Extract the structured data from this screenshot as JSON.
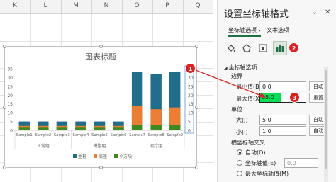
{
  "sheet": {
    "columns": [
      "K",
      "L",
      "M",
      "N",
      "O",
      "P",
      "Q"
    ]
  },
  "chart_data": {
    "type": "bar",
    "title": "图表标题",
    "categories": [
      "Sample1",
      "Sample2",
      "Sample3",
      "Sample4",
      "Sample5",
      "Sample6",
      "Sample7",
      "Sample8",
      "Sample9"
    ],
    "groups": [
      {
        "label": "正常组",
        "from": 0,
        "to": 2
      },
      {
        "label": "模型组",
        "from": 3,
        "to": 5
      },
      {
        "label": "治疗组",
        "from": 6,
        "to": 8
      }
    ],
    "bars": [
      {
        "name": "主柱",
        "color": "#1f6e8c",
        "values": [
          5,
          5,
          5,
          5,
          5,
          5,
          33,
          32,
          33
        ]
      },
      {
        "name": "底座",
        "color": "#ed7d31",
        "values": [
          2.5,
          2.5,
          2.5,
          2.5,
          2.5,
          2.5,
          14,
          12,
          13
        ]
      },
      {
        "name": "小方块",
        "color": "#3c8a1e",
        "values": [
          1.5,
          1.5,
          1.5,
          1.5,
          1.5,
          1.5,
          3,
          3,
          3
        ]
      }
    ],
    "primary_axis": {
      "ticks": [
        "0",
        "5",
        "10",
        "15",
        "20",
        "25",
        "30",
        "35"
      ],
      "ylim": [
        0,
        35
      ]
    },
    "secondary_axis": {
      "ticks": [
        "0",
        "5",
        "10",
        "15",
        "20",
        "25",
        "30",
        "35"
      ],
      "ylim": [
        0,
        35
      ]
    },
    "legend_position": "bottom",
    "grid": false
  },
  "panel": {
    "title": "设置坐标轴格式",
    "tabs": [
      "坐标轴选项",
      "文本选项"
    ],
    "section": "坐标轴选项",
    "bounds_label": "边界",
    "min_label": "最小值(B)",
    "min_value": "0.0",
    "max_label": "最大值(X)",
    "max_value": "35.0",
    "auto_label": "自动",
    "reset_label": "重置",
    "units_label": "单位",
    "major_label": "大(J)",
    "major_value": "5.0",
    "minor_label": "小(I)",
    "minor_value": "1.0",
    "cross_label": "横坐标轴交叉",
    "cross_options": [
      "自动(O)",
      "坐标轴值(E)",
      "最大坐标轴值(M)"
    ],
    "cross_value": "0.0"
  },
  "annotations": [
    "1",
    "2",
    "3"
  ],
  "colors": {
    "accent": "#1e7145",
    "highlight": "#00e050",
    "marker": "#e02020"
  }
}
